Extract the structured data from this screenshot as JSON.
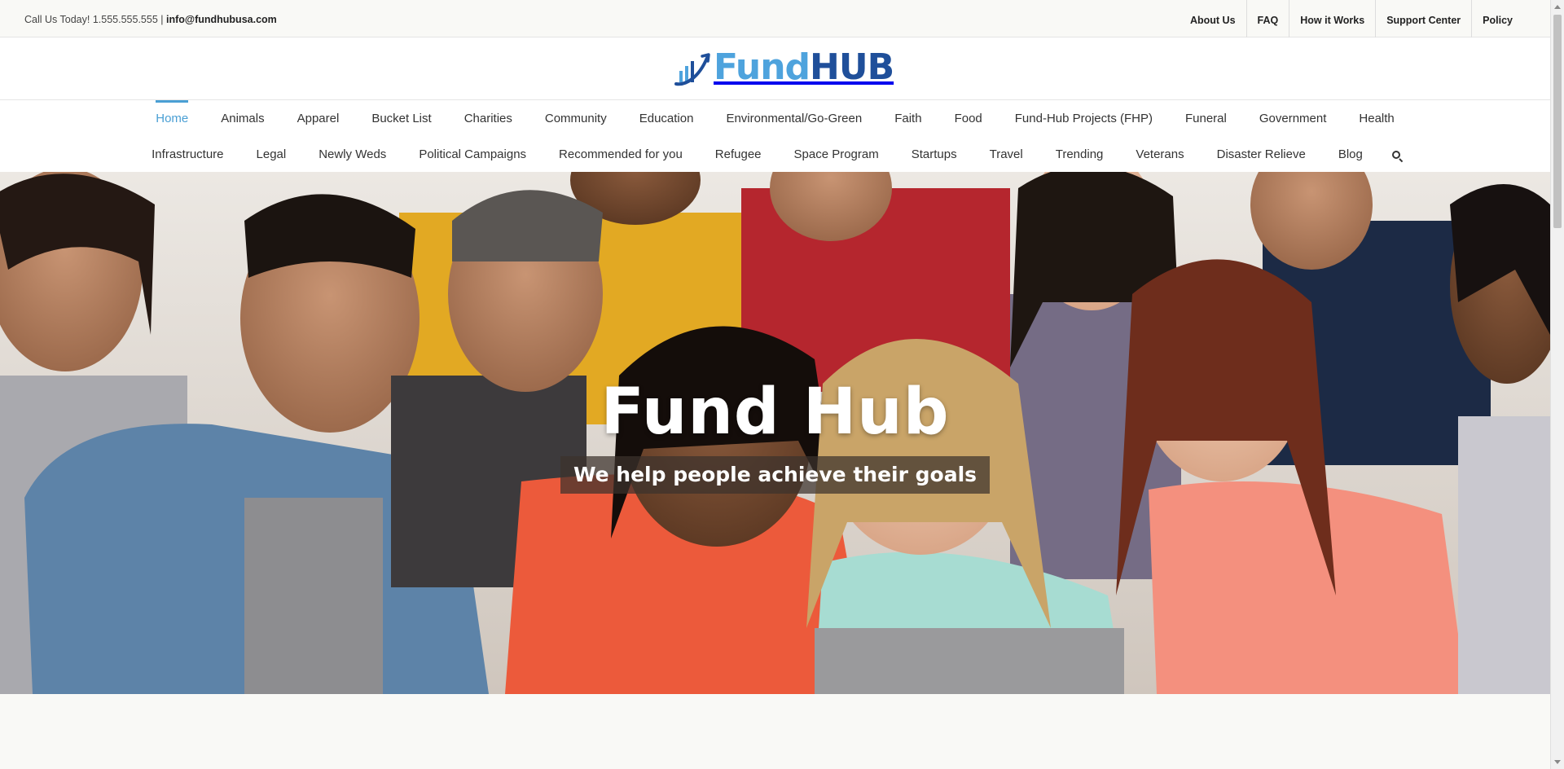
{
  "topbar": {
    "phone_text": "Call Us Today! 1.555.555.555  |",
    "email": "info@fundhubusa.com",
    "links": [
      "About Us",
      "FAQ",
      "How it Works",
      "Support Center",
      "Policy"
    ]
  },
  "logo": {
    "fund": "Fund",
    "hub": "HUB",
    "colors": {
      "fund": "#4ea3dd",
      "hub": "#1f4f9a"
    }
  },
  "nav": {
    "row1": [
      "Home",
      "Animals",
      "Apparel",
      "Bucket List",
      "Charities",
      "Community",
      "Education",
      "Environmental/Go-Green",
      "Faith",
      "Food",
      "Fund-Hub Projects (FHP)",
      "Funeral",
      "Government",
      "Health"
    ],
    "row2": [
      "Infrastructure",
      "Legal",
      "Newly Weds",
      "Political Campaigns",
      "Recommended for you",
      "Refugee",
      "Space Program",
      "Startups",
      "Travel",
      "Trending",
      "Veterans",
      "Disaster Relieve",
      "Blog"
    ],
    "active": "Home",
    "accent_color": "#4a9fd4",
    "search_icon": "search-icon"
  },
  "hero": {
    "title": "Fund Hub",
    "subtitle": "We help people achieve their goals"
  }
}
